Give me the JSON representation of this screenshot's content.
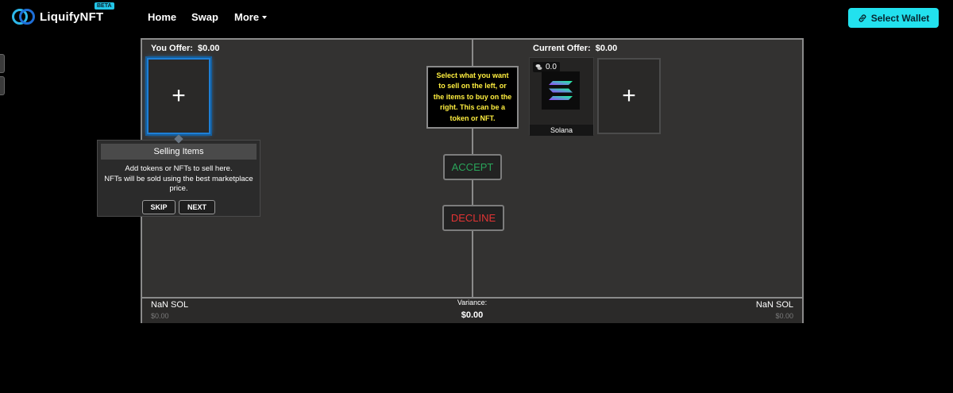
{
  "brand": {
    "name": "LiquifyNFT",
    "badge": "BETA"
  },
  "nav": {
    "home": "Home",
    "swap": "Swap",
    "more": "More"
  },
  "wallet": {
    "label": "Select Wallet"
  },
  "offer": {
    "you_label": "You Offer:",
    "you_value": "$0.00",
    "current_label": "Current Offer:",
    "current_value": "$0.00",
    "add_symbol": "+"
  },
  "instruction": "Select what you want to sell on the left, or the items to buy on the right. This can be a token or NFT.",
  "token": {
    "amount": "0.0",
    "name": "Solana"
  },
  "actions": {
    "accept": "ACCEPT",
    "decline": "DECLINE"
  },
  "footer": {
    "left_sol": "NaN SOL",
    "left_usd": "$0.00",
    "variance_label": "Variance:",
    "variance_value": "$0.00",
    "right_sol": "NaN SOL",
    "right_usd": "$0.00"
  },
  "tooltip": {
    "title": "Selling Items",
    "line1": "Add tokens or NFTs to sell here.",
    "line2": "NFTs will be sold using the best marketplace price.",
    "skip": "SKIP",
    "next": "NEXT"
  },
  "colors": {
    "accent": "#22e1ee",
    "accept": "#2aa45a",
    "decline": "#e33434",
    "instruction": "#ffef3f"
  }
}
